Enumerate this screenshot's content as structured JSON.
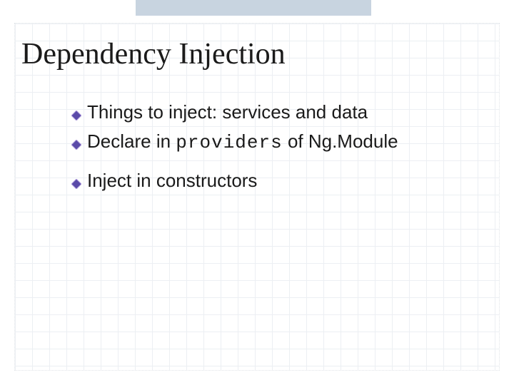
{
  "slide": {
    "title": "Dependency Injection",
    "bullets": [
      {
        "prefix": "Things to inject: services and data",
        "code": "",
        "suffix": ""
      },
      {
        "prefix": "Declare in ",
        "code": "providers",
        "suffix": " of Ng.Module"
      },
      {
        "prefix": "Inject in constructors",
        "code": "",
        "suffix": ""
      }
    ]
  }
}
